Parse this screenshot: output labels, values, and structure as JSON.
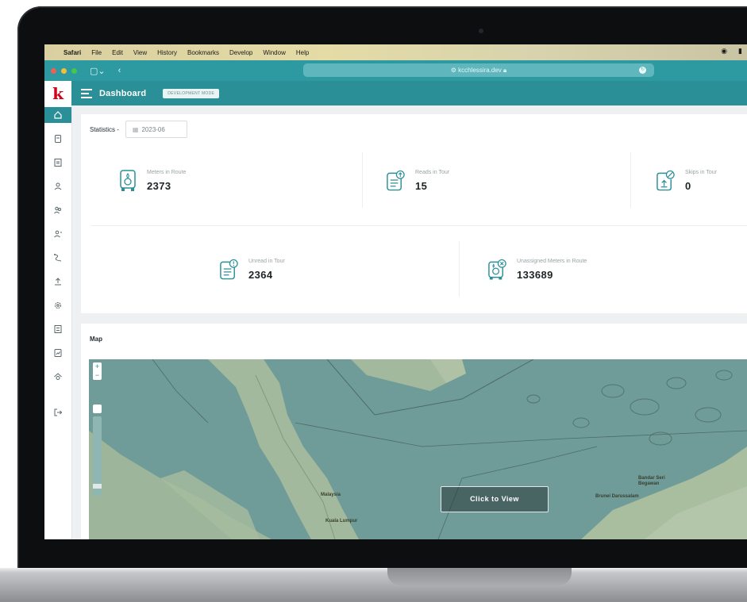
{
  "mac_menubar": {
    "items": [
      "Safari",
      "File",
      "Edit",
      "View",
      "History",
      "Bookmarks",
      "Develop",
      "Window",
      "Help"
    ]
  },
  "browser": {
    "url": "kcchlessira.dev",
    "reload_icon": "reload-icon"
  },
  "header": {
    "logo": "k",
    "title": "Dashboard",
    "badge": "DEVELOPMENT MODE"
  },
  "sidebar": {
    "icons": [
      "home-icon",
      "meter-icon",
      "document-icon",
      "user-icon",
      "users-icon",
      "group-icon",
      "route-icon",
      "upload-icon",
      "settings-icon",
      "list-icon",
      "report-icon",
      "gear-home-icon",
      "logout-icon"
    ]
  },
  "statistics": {
    "label": "Statistics -",
    "date_value": "2023-06",
    "cards": [
      {
        "label": "Meters in Route",
        "value": "2373",
        "icon": "meter-icon"
      },
      {
        "label": "Reads in Tour",
        "value": "15",
        "icon": "read-doc-icon"
      },
      {
        "label": "Skips in Tour",
        "value": "0",
        "icon": "skip-icon"
      },
      {
        "label": "Unread in Tour",
        "value": "2364",
        "icon": "unread-doc-icon"
      },
      {
        "label": "Unassigned Meters in Route",
        "value": "133689",
        "icon": "unassigned-meter-icon"
      }
    ]
  },
  "map": {
    "title": "Map",
    "zoom_in": "+",
    "zoom_out": "−",
    "click_to_view": "Click to View",
    "labels": [
      "Malaysia",
      "Kuala Lumpur",
      "Brunei Darussalam",
      "Bandar Seri Begawan"
    ]
  },
  "colors": {
    "primary": "#2b8f97",
    "logo_red": "#d0021b",
    "map_water": "#6f9c98",
    "map_land": "#9db59a"
  }
}
